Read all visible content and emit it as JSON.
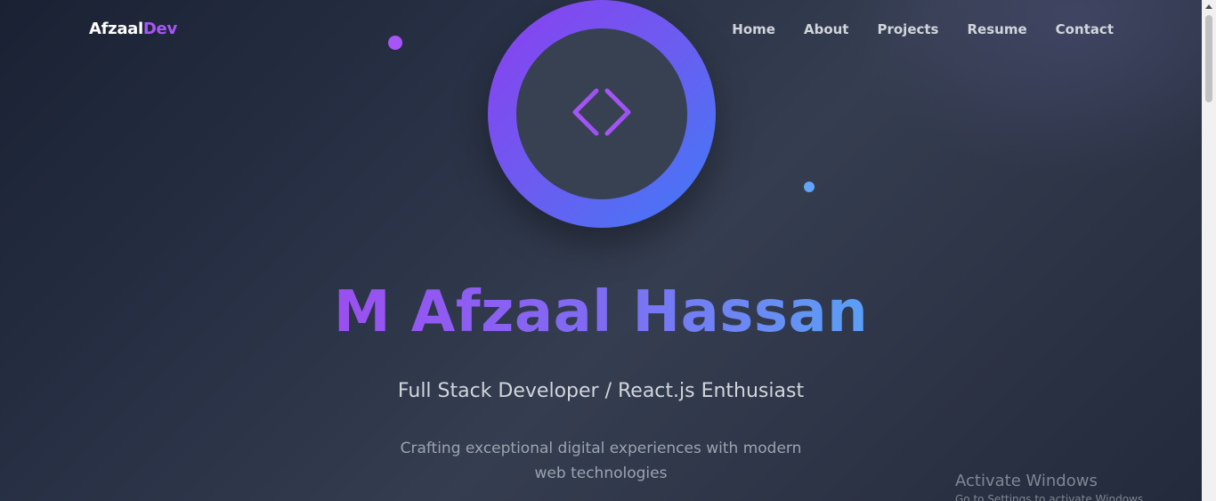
{
  "brand": {
    "logo_part1": "Afzaal",
    "logo_part2": "Dev",
    "accent_color": "#a855f7"
  },
  "nav": {
    "items": [
      {
        "label": "Home"
      },
      {
        "label": "About"
      },
      {
        "label": "Projects"
      },
      {
        "label": "Resume"
      },
      {
        "label": "Contact"
      }
    ]
  },
  "hero": {
    "avatar_icon": "code-icon",
    "name": "M Afzaal Hassan",
    "subtitle": "Full Stack Developer / React.js Enthusiast",
    "tagline": "Crafting exceptional digital experiences with modern web technologies",
    "gradient_start": "#9b4ff0",
    "gradient_end": "#5aa0f5"
  },
  "watermark": {
    "title": "Activate Windows",
    "subtitle": "Go to Settings to activate Windows."
  },
  "colors": {
    "background": "#2b3244",
    "ring_start": "#8b3ff0",
    "ring_end": "#3f7bf6",
    "dot_purple": "#a855f7",
    "dot_blue": "#60a5fa"
  }
}
